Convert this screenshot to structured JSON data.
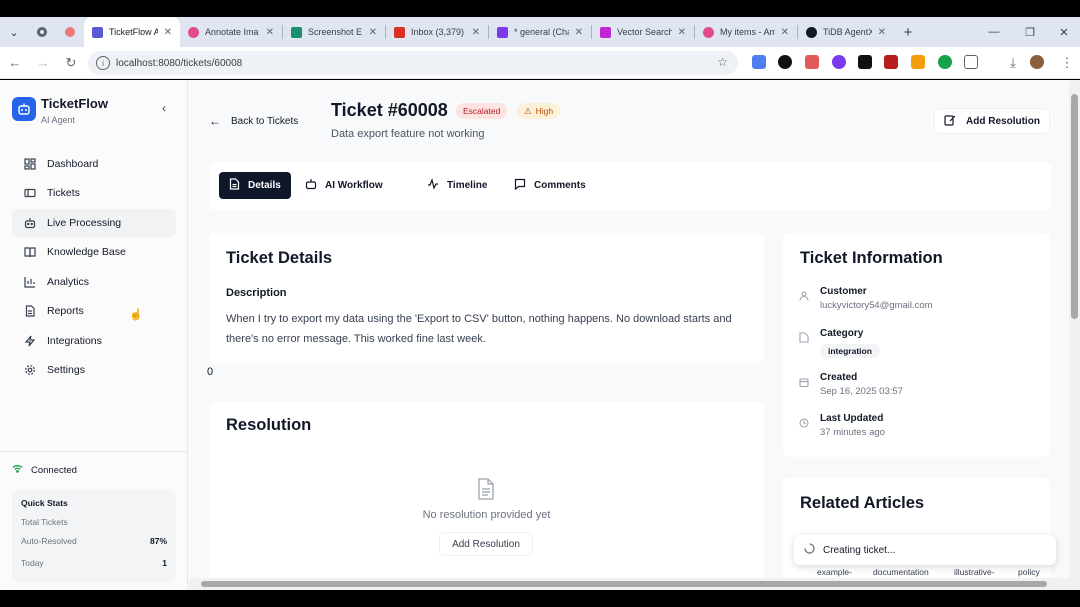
{
  "browser": {
    "tabs": [
      {
        "title": "TicketFlow AI",
        "color": "#5b5bd6",
        "active": true
      },
      {
        "title": "Annotate Ima",
        "color": "#e14b8a"
      },
      {
        "title": "Screenshot E",
        "color": "#1a8f6f"
      },
      {
        "title": "Inbox (3,379)",
        "color": "#d93025"
      },
      {
        "title": "* general (Cha",
        "color": "#7c3aed"
      },
      {
        "title": "Vector Search",
        "color": "#c026d3"
      },
      {
        "title": "My items - Am",
        "color": "#e14b8a"
      },
      {
        "title": "TiDB AgentX",
        "color": "#111827"
      }
    ],
    "url": "localhost:8080/tickets/60008"
  },
  "sidebar": {
    "brand": "TicketFlow",
    "brand_sub": "AI Agent",
    "items": [
      {
        "label": "Dashboard",
        "icon": "dashboard-icon"
      },
      {
        "label": "Tickets",
        "icon": "ticket-icon"
      },
      {
        "label": "Live Processing",
        "icon": "bot-icon"
      },
      {
        "label": "Knowledge Base",
        "icon": "book-icon"
      },
      {
        "label": "Analytics",
        "icon": "chart-icon"
      },
      {
        "label": "Reports",
        "icon": "report-icon"
      },
      {
        "label": "Integrations",
        "icon": "zap-icon"
      },
      {
        "label": "Settings",
        "icon": "gear-icon"
      }
    ],
    "connection": "Connected",
    "quick_stats": {
      "title": "Quick Stats",
      "total_label": "Total Tickets",
      "auto_label": "Auto-Resolved",
      "auto_value": "87%",
      "today_label": "Today",
      "today_value": "1"
    }
  },
  "header": {
    "back_label": "Back to Tickets",
    "ticket_title": "Ticket #60008",
    "status_badge": "Escalated",
    "priority_badge": "High",
    "subtitle": "Data export feature not working",
    "add_resolution": "Add Resolution"
  },
  "tabs": [
    "Details",
    "AI Workflow",
    "Timeline",
    "Comments"
  ],
  "details": {
    "title": "Ticket Details",
    "desc_label": "Description",
    "desc_text": "When I try to export my data using the 'Export to CSV' button, nothing happens. No download starts and there's no error message. This worked fine last week."
  },
  "stray_value": "0",
  "resolution": {
    "title": "Resolution",
    "empty_text": "No resolution provided yet",
    "button": "Add Resolution"
  },
  "info": {
    "title": "Ticket Information",
    "customer_label": "Customer",
    "customer_value": "luckyvictory54@gmail.com",
    "category_label": "Category",
    "category_value": "integration",
    "created_label": "Created",
    "created_value": "Sep 16, 2025 03:57",
    "updated_label": "Last Updated",
    "updated_value": "37 minutes ago"
  },
  "related": {
    "title": "Related Articles",
    "tags": [
      "example-",
      "documentation",
      "illustrative-",
      "policy"
    ]
  },
  "toast": "Creating ticket...",
  "colors": {
    "accent": "#2563eb",
    "active_tab": "#0f172a",
    "escalated_bg": "#fde2e2",
    "escalated_fg": "#b91c1c",
    "high_bg": "#fdf0d9",
    "high_fg": "#b45309",
    "connected": "#16a34a"
  }
}
